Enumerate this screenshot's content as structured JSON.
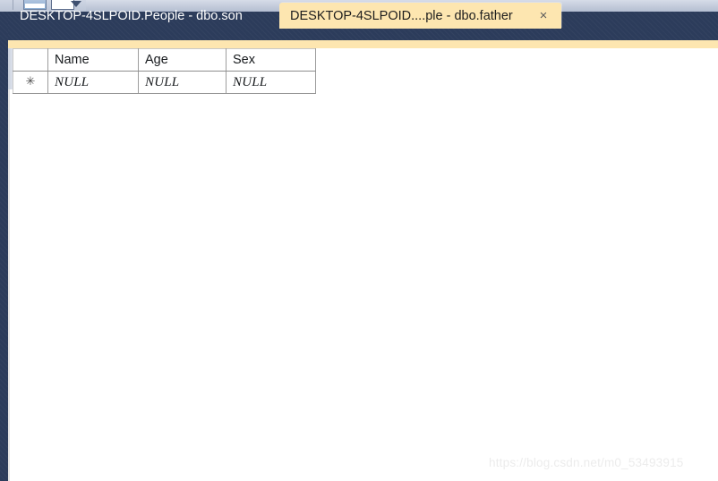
{
  "toolbar": {
    "buttons": [
      {
        "name": "execute-button",
        "state": "filled"
      },
      {
        "name": "new-query-button",
        "state": "outline"
      }
    ],
    "dropdown_icon": "chevron-down-icon"
  },
  "tabs": [
    {
      "label": "DESKTOP-4SLPOID.People - dbo.son",
      "active": false,
      "closable": false
    },
    {
      "label": "DESKTOP-4SLPOID....ple - dbo.father",
      "active": true,
      "closable": true,
      "close_icon": "close-icon",
      "close_glyph": "×"
    }
  ],
  "grid": {
    "row_header_marker": "✳",
    "columns": [
      "Name",
      "Age",
      "Sex"
    ],
    "rows": [
      {
        "marker": "✳",
        "cells": [
          "NULL",
          "NULL",
          "NULL"
        ]
      }
    ]
  },
  "watermark": {
    "text": "https://blog.csdn.net/m0_53493915"
  },
  "colors": {
    "tabbar_background": "#2c3c5b",
    "active_tab_background": "#fde6b0",
    "grid_border": "#c8c8c8",
    "page_background": "#ffffff",
    "watermark_text": "#ececec"
  }
}
